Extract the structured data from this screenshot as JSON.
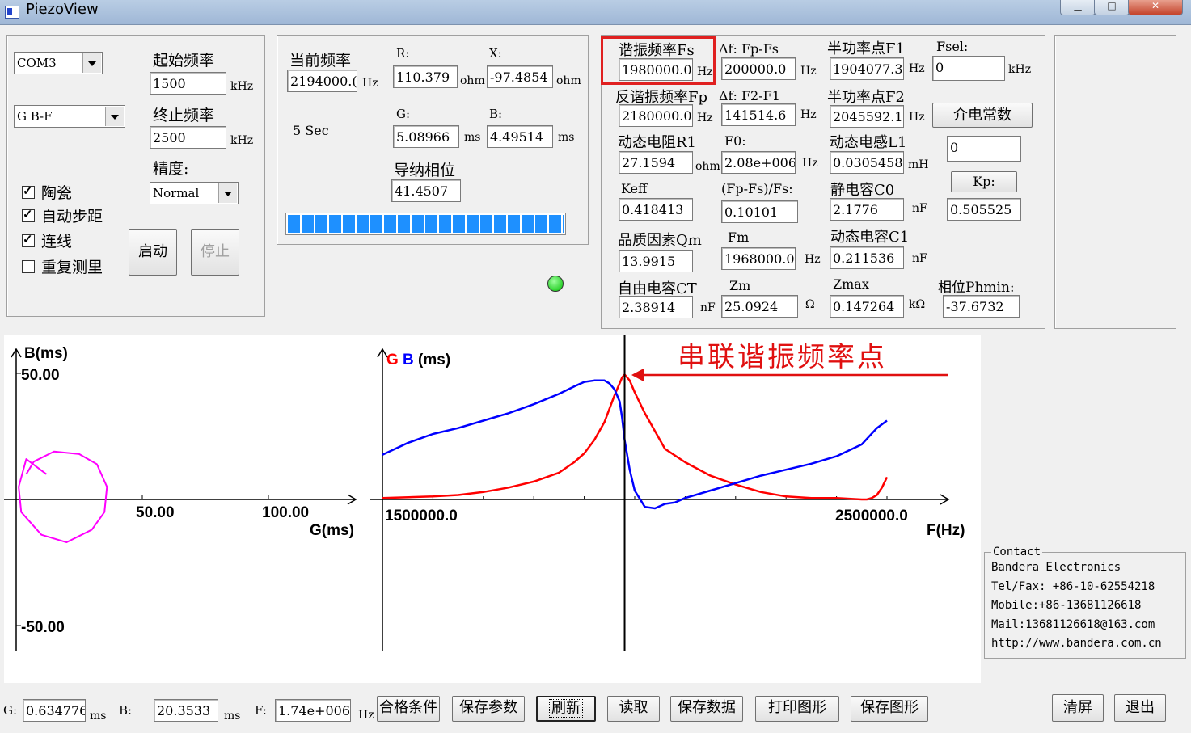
{
  "window": {
    "title": "PiezoView",
    "controls": [
      "minimize",
      "maximize",
      "close"
    ]
  },
  "control_panel": {
    "port": "COM3",
    "mode": "G B-F",
    "start_freq_label": "起始频率",
    "start_freq": "1500",
    "stop_freq_label": "终止频率",
    "stop_freq": "2500",
    "freq_unit": "kHz",
    "precision_label": "精度:",
    "precision": "Normal",
    "checkboxes": [
      {
        "label": "陶瓷",
        "checked": true
      },
      {
        "label": "自动步距",
        "checked": true
      },
      {
        "label": "连线",
        "checked": true
      },
      {
        "label": "重复测里",
        "checked": false
      }
    ],
    "start_button": "启动",
    "stop_button": "停止"
  },
  "measure": {
    "current_freq_label": "当前频率",
    "current_freq": "2194000.(",
    "current_freq_unit": "Hz",
    "r_label": "R:",
    "r_value": "110.379",
    "r_unit": "ohm",
    "x_label": "X:",
    "x_value": "-97.4854",
    "x_unit": "ohm",
    "time_text": "5 Sec",
    "g_label": "G:",
    "g_value": "5.08966",
    "g_unit": "ms",
    "b_label": "B:",
    "b_value": "4.49514",
    "b_unit": "ms",
    "phase_label": "导纳相位",
    "phase_value": "41.4507",
    "progress_percent": 100,
    "status_color": "#00c000"
  },
  "results": {
    "fs_label": "谐振频率Fs",
    "fs": "1980000.0",
    "fs_unit": "Hz",
    "df1_label": "Δf: Fp-Fs",
    "df1": "200000.0",
    "df1_unit": "Hz",
    "f1_label": "半功率点F1",
    "f1": "1904077.3",
    "f1_unit": "Hz",
    "fsel_label": "Fsel:",
    "fsel": "0",
    "fsel_unit": "kHz",
    "fp_label": "反谐振频率Fp",
    "fp": "2180000.0",
    "fp_unit": "Hz",
    "df2_label": "Δf: F2-F1",
    "df2": "141514.6",
    "df2_unit": "Hz",
    "f2_label": "半功率点F2",
    "f2": "2045592.1",
    "f2_unit": "Hz",
    "dielectric_button": "介电常数",
    "r1_label": "动态电阻R1",
    "r1": "27.1594",
    "r1_unit": "ohm",
    "f0_label": "F0:",
    "f0": "2.08e+006",
    "f0_unit": "Hz",
    "l1_label": "动态电感L1",
    "l1": "0.0305458",
    "l1_unit": "mH",
    "dielectric_value": "0",
    "keff_label": "Keff",
    "keff": "0.418413",
    "fpfs_label": "(Fp-Fs)/Fs:",
    "fpfs": "0.10101",
    "c0_label": "静电容C0",
    "c0": "2.1776",
    "c0_unit": "nF",
    "kp_button": "Kp:",
    "kp": "0.505525",
    "qm_label": "品质因素Qm",
    "qm": "13.9915",
    "fm_label": "Fm",
    "fm": "1968000.0",
    "fm_unit": "Hz",
    "c1_label": "动态电容C1",
    "c1": "0.211536",
    "c1_unit": "nF",
    "ct_label": "自由电容CT",
    "ct": "2.38914",
    "ct_unit": "nF",
    "zm_label": "Zm",
    "zm": "25.0924",
    "zm_unit": "Ω",
    "zmax_label": "Zmax",
    "zmax": "0.147264",
    "zmax_unit": "kΩ",
    "phmin_label": "相位Phmin:",
    "phmin": "-37.6732"
  },
  "chart_data": [
    {
      "type": "scatter",
      "xlabel": "G(ms)",
      "ylabel": "B(ms)",
      "x_ticks": [
        "50.00",
        "100.00"
      ],
      "y_ticks": [
        "50.00",
        "-50.00"
      ],
      "series": [
        {
          "color": "#ff00ff",
          "points": [
            [
              12,
              10
            ],
            [
              4,
              16
            ],
            [
              1,
              5
            ],
            [
              2,
              -5
            ],
            [
              10,
              -14
            ],
            [
              20,
              -17
            ],
            [
              30,
              -12
            ],
            [
              35,
              -5
            ],
            [
              36,
              5
            ],
            [
              32,
              14
            ],
            [
              25,
              18
            ],
            [
              15,
              19
            ],
            [
              7,
              15
            ],
            [
              4,
              10
            ]
          ]
        }
      ]
    },
    {
      "type": "line",
      "title": "G B (ms)",
      "title_colors": {
        "G": "#ff0000",
        "B": "#0000ff"
      },
      "xlabel": "F(Hz)",
      "x_ticks": [
        "1500000.0",
        "2500000.0"
      ],
      "xlim": [
        1500000,
        2500000
      ],
      "ylim": [
        0,
        1
      ],
      "cursor_x": 1980000,
      "annotation": "串联谐振频率点",
      "annotation_color": "#e01010",
      "series": [
        {
          "name": "G",
          "color": "#ff0000",
          "x": [
            1500000,
            1600000,
            1650000,
            1700000,
            1750000,
            1800000,
            1850000,
            1880000,
            1900000,
            1920000,
            1940000,
            1960000,
            1975000,
            1980000,
            1990000,
            2000000,
            2020000,
            2040000,
            2060000,
            2100000,
            2150000,
            2200000,
            2250000,
            2300000,
            2350000,
            2400000,
            2450000,
            2460000,
            2470000,
            2480000,
            2490000,
            2500000
          ],
          "y": [
            0.01,
            0.02,
            0.03,
            0.05,
            0.08,
            0.12,
            0.18,
            0.25,
            0.31,
            0.4,
            0.52,
            0.7,
            0.82,
            0.84,
            0.8,
            0.72,
            0.58,
            0.46,
            0.34,
            0.25,
            0.16,
            0.1,
            0.05,
            0.02,
            0.01,
            0.01,
            0.0,
            0.0,
            0.01,
            0.03,
            0.08,
            0.15
          ]
        },
        {
          "name": "B",
          "color": "#0000ff",
          "x": [
            1500000,
            1550000,
            1600000,
            1650000,
            1700000,
            1750000,
            1800000,
            1850000,
            1880000,
            1900000,
            1920000,
            1940000,
            1950000,
            1960000,
            1970000,
            1975000,
            1980000,
            1990000,
            2000000,
            2020000,
            2040000,
            2060000,
            2080000,
            2100000,
            2150000,
            2200000,
            2250000,
            2300000,
            2350000,
            2400000,
            2450000,
            2480000,
            2500000
          ],
          "y": [
            0.3,
            0.38,
            0.44,
            0.48,
            0.53,
            0.58,
            0.64,
            0.71,
            0.76,
            0.79,
            0.8,
            0.8,
            0.78,
            0.74,
            0.66,
            0.55,
            0.4,
            0.2,
            0.06,
            -0.05,
            -0.06,
            -0.03,
            -0.02,
            0.01,
            0.06,
            0.11,
            0.16,
            0.2,
            0.24,
            0.29,
            0.37,
            0.48,
            0.53
          ]
        }
      ]
    }
  ],
  "contact": {
    "title": "Contact",
    "lines": [
      "Bandera Electronics",
      "Tel/Fax: +86-10-62554218",
      "Mobile:+86-13681126618",
      "Mail:13681126618@163.com",
      "http://www.bandera.com.cn"
    ]
  },
  "bottom_bar": {
    "g_label": "G:",
    "g_value": "0.634776",
    "g_unit": "ms",
    "b_label": "B:",
    "b_value": "20.3533",
    "b_unit": "ms",
    "f_label": "F:",
    "f_value": "1.74e+006",
    "f_unit": "Hz",
    "buttons": [
      "合格条件",
      "保存参数",
      "刷新",
      "读取",
      "保存数据",
      "打印图形",
      "保存图形"
    ],
    "clear_button": "清屏",
    "exit_button": "退出"
  },
  "highlight_color": "#e02020"
}
